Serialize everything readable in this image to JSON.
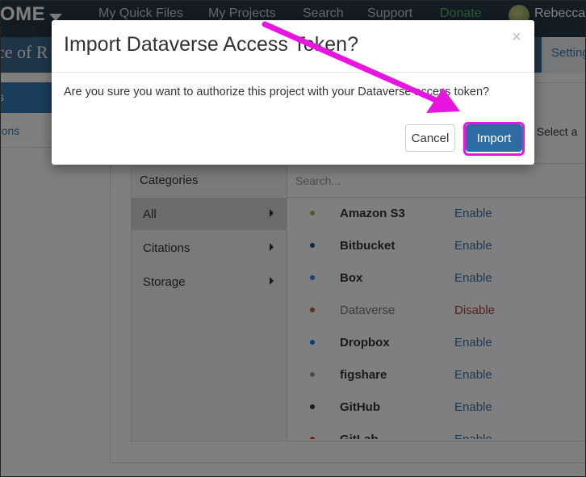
{
  "nav": {
    "brand": "OME",
    "links": [
      "My Quick Files",
      "My Projects",
      "Search",
      "Support",
      "Donate"
    ],
    "user": "Rebecca"
  },
  "project": {
    "title": "ce of R",
    "settings_label": "Settings"
  },
  "side_menu": {
    "active_label": "s",
    "item_label": "-ons"
  },
  "panel": {
    "hint_text": ". Select a"
  },
  "categories": {
    "header": "Categories",
    "items": [
      "All",
      "Citations",
      "Storage"
    ]
  },
  "search": {
    "placeholder": "Search..."
  },
  "addons": [
    {
      "name": "Amazon S3",
      "action": "Enable",
      "icon_color": "#8bc34a"
    },
    {
      "name": "Bitbucket",
      "action": "Enable",
      "icon_color": "#205081"
    },
    {
      "name": "Box",
      "action": "Enable",
      "icon_color": "#2486fc"
    },
    {
      "name": "Dataverse",
      "action": "Disable",
      "icon_color": "#c55b28"
    },
    {
      "name": "Dropbox",
      "action": "Enable",
      "icon_color": "#007ee5"
    },
    {
      "name": "figshare",
      "action": "Enable",
      "icon_color": "#999999"
    },
    {
      "name": "GitHub",
      "action": "Enable",
      "icon_color": "#333333"
    },
    {
      "name": "GitLab",
      "action": "Enable",
      "icon_color": "#e24329"
    }
  ],
  "modal": {
    "title": "Import Dataverse Access Token?",
    "close_glyph": "×",
    "body": "Are you sure you want to authorize this project with your Dataverse access token?",
    "cancel_label": "Cancel",
    "import_label": "Import"
  },
  "colors": {
    "annotation": "#e815e0",
    "primary": "#2e6da4",
    "nav_bg": "#263947",
    "project_bar": "#3e6a8f"
  }
}
